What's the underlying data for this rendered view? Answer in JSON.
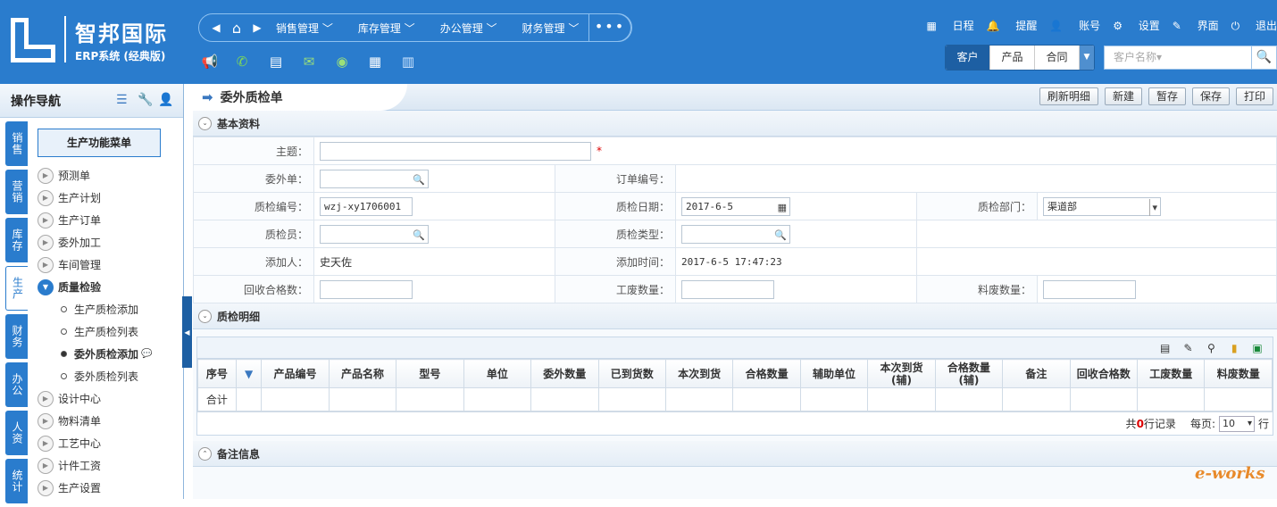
{
  "brand": {
    "name": "智邦国际",
    "sub": "ERP系统 (经典版)"
  },
  "nav": {
    "menus": [
      "销售管理",
      "库存管理",
      "办公管理",
      "财务管理"
    ],
    "more": "•••"
  },
  "toplinks": [
    "日程",
    "提醒",
    "账号",
    "设置",
    "界面",
    "退出"
  ],
  "search_tabs": [
    "客户",
    "产品",
    "合同"
  ],
  "search": {
    "placeholder": "客户名称▾"
  },
  "sidebar": {
    "title": "操作导航",
    "vtabs": [
      "销售",
      "营销",
      "库存",
      "生产",
      "财务",
      "办公",
      "人资",
      "统计"
    ],
    "function_menu": "生产功能菜单",
    "items": [
      {
        "label": "预测单"
      },
      {
        "label": "生产计划"
      },
      {
        "label": "生产订单"
      },
      {
        "label": "委外加工"
      },
      {
        "label": "车间管理"
      },
      {
        "label": "质量检验"
      },
      {
        "label": "生产质检添加"
      },
      {
        "label": "生产质检列表"
      },
      {
        "label": "委外质检添加"
      },
      {
        "label": "委外质检列表"
      },
      {
        "label": "设计中心"
      },
      {
        "label": "物料清单"
      },
      {
        "label": "工艺中心"
      },
      {
        "label": "计件工资"
      },
      {
        "label": "生产设置"
      }
    ]
  },
  "page": {
    "title": "委外质检单",
    "buttons": [
      "刷新明细",
      "新建",
      "暂存",
      "保存",
      "打印"
    ]
  },
  "sections": {
    "basic": "基本资料",
    "detail": "质检明细",
    "notes": "备注信息"
  },
  "form": {
    "subject_label": "主题：",
    "outsource_label": "委外单：",
    "order_no_label": "订单编号：",
    "qc_no_label": "质检编号：",
    "qc_no": "wzj-xy1706001",
    "qc_date_label": "质检日期：",
    "qc_date": "2017-6-5",
    "qc_dept_label": "质检部门：",
    "qc_dept": "渠道部",
    "inspector_label": "质检员：",
    "qc_type_label": "质检类型：",
    "added_by_label": "添加人：",
    "added_by": "史天佐",
    "added_time_label": "添加时间：",
    "added_time": "2017-6-5 17:47:23",
    "recovered_label": "回收合格数：",
    "work_waste_label": "工废数量：",
    "material_waste_label": "料废数量："
  },
  "grid": {
    "headers": [
      "序号",
      "▼",
      "产品编号",
      "产品名称",
      "型号",
      "单位",
      "委外数量",
      "已到货数",
      "本次到货",
      "合格数量",
      "辅助单位",
      "本次到货\n(辅)",
      "合格数量\n(辅)",
      "备注",
      "回收合格数",
      "工废数量",
      "料废数量"
    ],
    "total_label": "合计"
  },
  "pager": {
    "prefix": "共",
    "count": "0",
    "suffix": "行记录",
    "per_page_label": "每页:",
    "per_page": "10",
    "unit": "行"
  },
  "watermark": "e-works"
}
